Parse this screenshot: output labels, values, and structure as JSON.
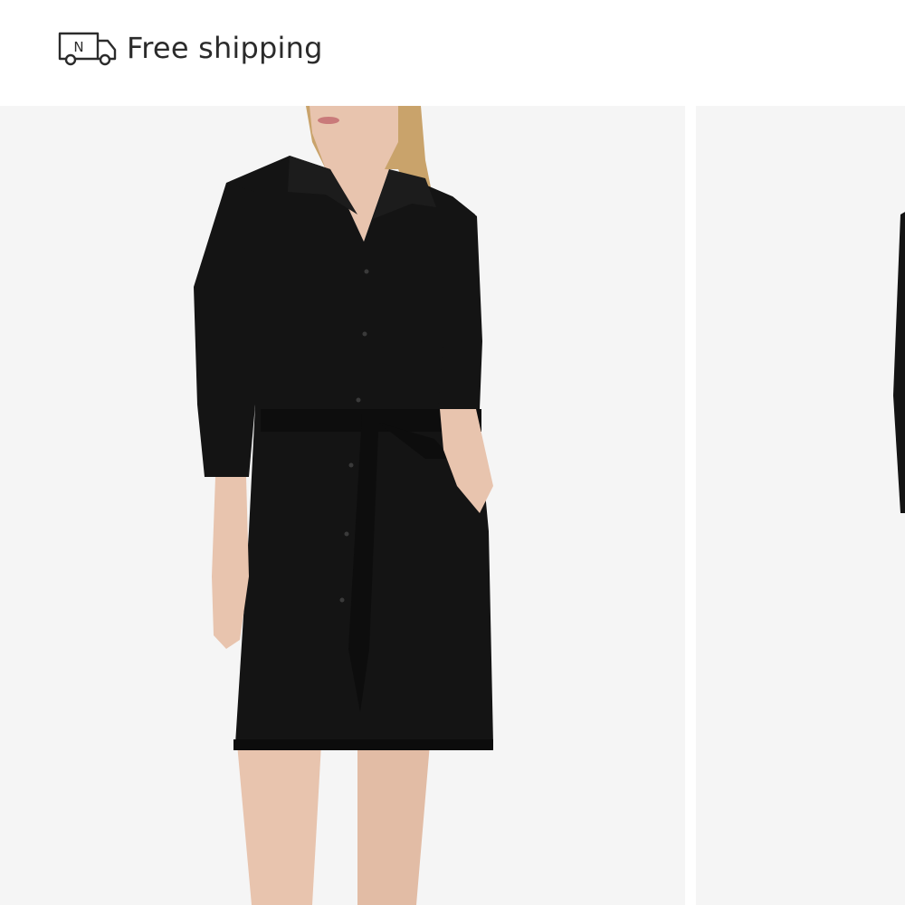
{
  "shipping": {
    "icon": "delivery-truck-icon",
    "badge_letter": "N",
    "label": "Free shipping"
  },
  "gallery": {
    "images": [
      {
        "icon": "product-photo",
        "description_name": "model-wearing-black-belted-shirt-dress"
      },
      {
        "icon": "product-photo",
        "description_name": "next-product-image-partial"
      }
    ]
  },
  "colors": {
    "text": "#2b2b2b",
    "photo_background": "#f5f5f5",
    "dress": "#141414",
    "skin": "#e8c4ae"
  }
}
